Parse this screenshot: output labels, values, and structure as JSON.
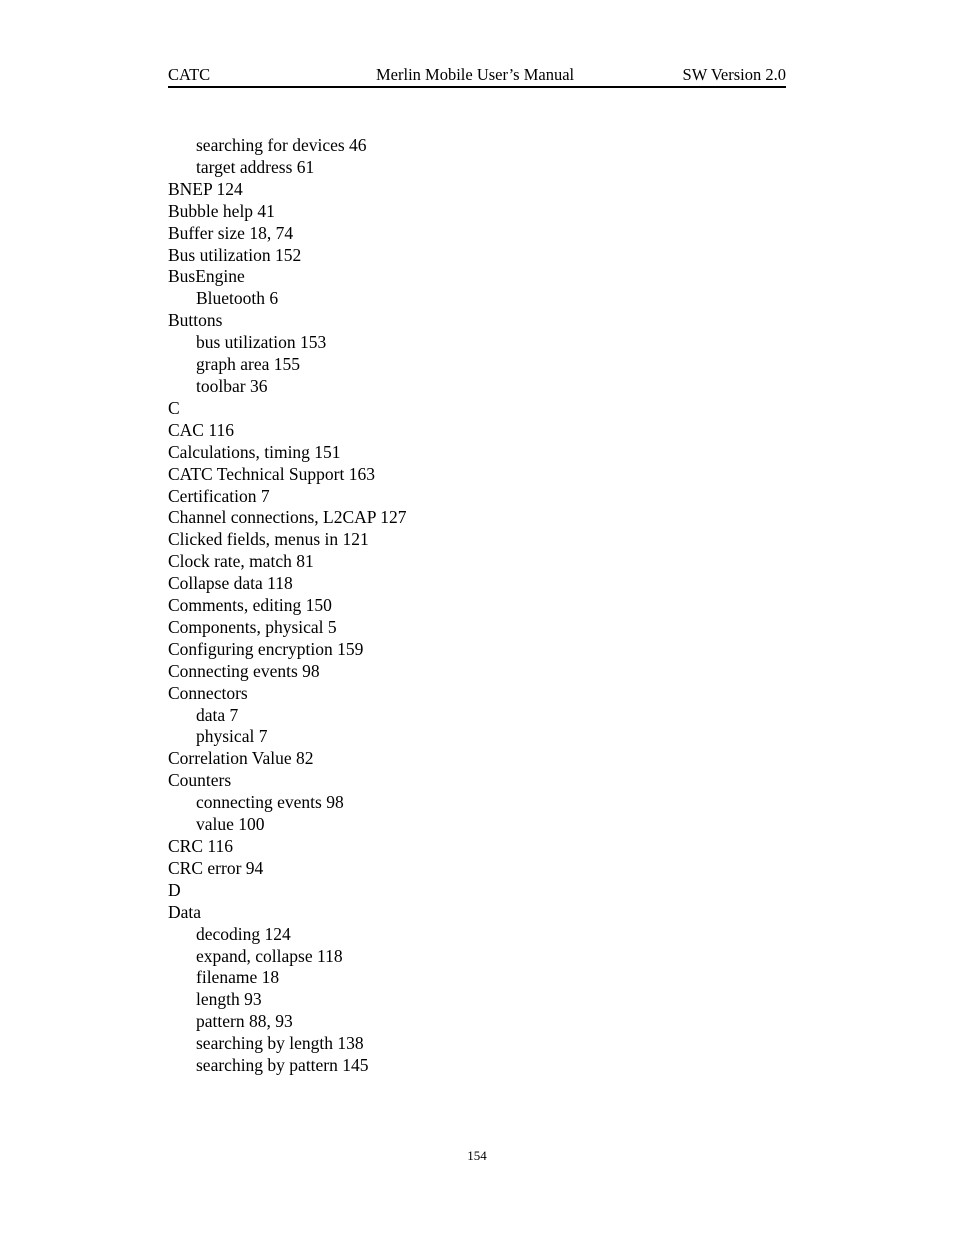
{
  "header": {
    "left": "CATC",
    "center": "Merlin Mobile User’s Manual",
    "right": "SW Version 2.0"
  },
  "index_entries": [
    {
      "level": 1,
      "text": "searching for devices 46"
    },
    {
      "level": 1,
      "text": "target address 61"
    },
    {
      "level": 0,
      "text": "BNEP 124"
    },
    {
      "level": 0,
      "text": "Bubble help 41"
    },
    {
      "level": 0,
      "text": "Buffer size 18, 74"
    },
    {
      "level": 0,
      "text": "Bus utilization 152"
    },
    {
      "level": 0,
      "text": "BusEngine"
    },
    {
      "level": 1,
      "text": "Bluetooth 6"
    },
    {
      "level": 0,
      "text": "Buttons"
    },
    {
      "level": 1,
      "text": "bus utilization 153"
    },
    {
      "level": 1,
      "text": "graph area 155"
    },
    {
      "level": 1,
      "text": "toolbar 36"
    },
    {
      "level": 0,
      "text": "C"
    },
    {
      "level": 0,
      "text": "CAC 116"
    },
    {
      "level": 0,
      "text": "Calculations, timing 151"
    },
    {
      "level": 0,
      "text": "CATC Technical Support 163"
    },
    {
      "level": 0,
      "text": "Certification 7"
    },
    {
      "level": 0,
      "text": "Channel connections, L2CAP 127"
    },
    {
      "level": 0,
      "text": "Clicked fields, menus in 121"
    },
    {
      "level": 0,
      "text": "Clock rate, match 81"
    },
    {
      "level": 0,
      "text": "Collapse data 118"
    },
    {
      "level": 0,
      "text": "Comments, editing 150"
    },
    {
      "level": 0,
      "text": "Components, physical 5"
    },
    {
      "level": 0,
      "text": "Configuring encryption 159"
    },
    {
      "level": 0,
      "text": "Connecting events 98"
    },
    {
      "level": 0,
      "text": "Connectors"
    },
    {
      "level": 1,
      "text": "data 7"
    },
    {
      "level": 1,
      "text": "physical 7"
    },
    {
      "level": 0,
      "text": "Correlation Value 82"
    },
    {
      "level": 0,
      "text": "Counters"
    },
    {
      "level": 1,
      "text": "connecting events 98"
    },
    {
      "level": 1,
      "text": "value 100"
    },
    {
      "level": 0,
      "text": "CRC 116"
    },
    {
      "level": 0,
      "text": "CRC error 94"
    },
    {
      "level": 0,
      "text": "D"
    },
    {
      "level": 0,
      "text": "Data"
    },
    {
      "level": 1,
      "text": "decoding 124"
    },
    {
      "level": 1,
      "text": "expand, collapse 118"
    },
    {
      "level": 1,
      "text": "filename 18"
    },
    {
      "level": 1,
      "text": "length 93"
    },
    {
      "level": 1,
      "text": "pattern 88, 93"
    },
    {
      "level": 1,
      "text": "searching by length 138"
    },
    {
      "level": 1,
      "text": "searching by pattern 145"
    }
  ],
  "footer": {
    "page_number": "154"
  }
}
